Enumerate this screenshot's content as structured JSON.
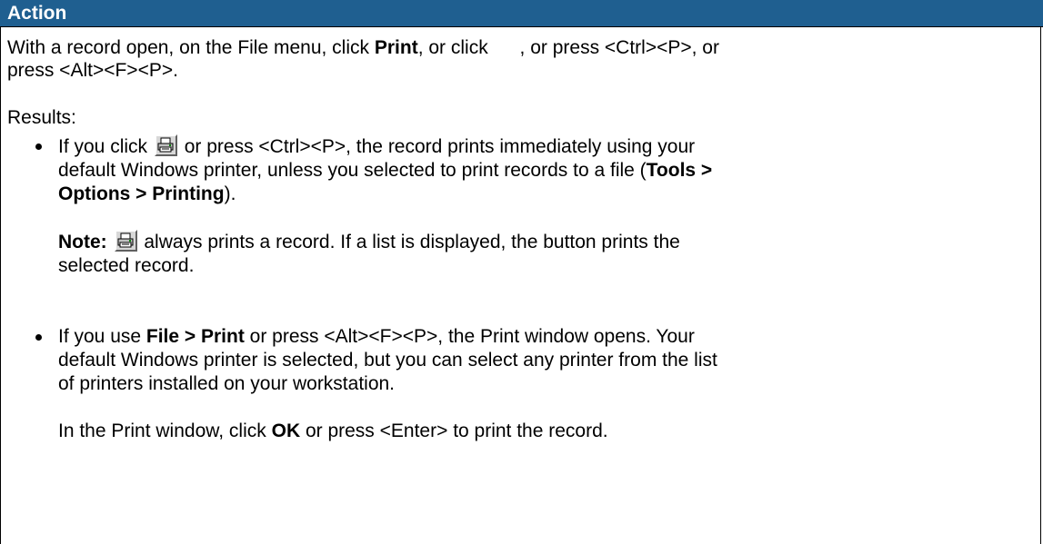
{
  "header": {
    "title": "Action"
  },
  "intro": {
    "line1_a": "With a record open, on the File menu, click ",
    "line1_b": "Print",
    "line1_c": ", or click ",
    "line1_d": ", or press <Ctrl><P>, or",
    "line2": "press <Alt><F><P>."
  },
  "results_label": "Results:",
  "bullet1": {
    "l1_a": "If you click ",
    "l1_b": " or press <Ctrl><P>, the record prints immediately using your",
    "l2": "default Windows printer, unless you selected to print records to a file (",
    "l2_bold": "Tools >",
    "l3_bold": "Options > Printing",
    "l3_end": ")."
  },
  "note": {
    "label": "Note:",
    "l1_b": " always prints a record. If a list is displayed, the button prints the",
    "l2": "selected record."
  },
  "bullet2": {
    "l1_a": "If you use ",
    "l1_bold": "File > Print",
    "l1_c": " or press <Alt><F><P>, the Print window opens. Your",
    "l2": "default Windows printer is selected, but you can select any printer from the list",
    "l3": "of printers installed on your workstation."
  },
  "final": {
    "a": "In the Print window, click ",
    "bold": "OK",
    "c": " or press <Enter> to print the record."
  },
  "icons": {
    "print": "printer-icon"
  }
}
